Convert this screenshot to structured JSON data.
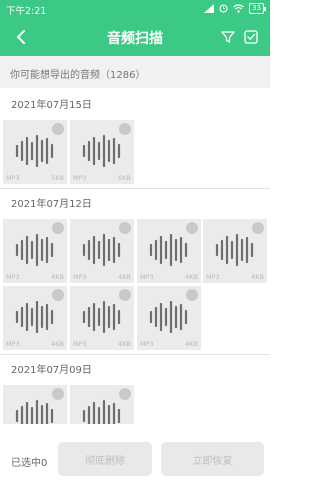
{
  "status_bar": {
    "time": "下午2:21",
    "battery": "33"
  },
  "nav": {
    "title": "音频扫描"
  },
  "summary": "你可能想导出的音频（1286）",
  "groups": [
    {
      "date": "2021年07月15日",
      "items": [
        {
          "format": "MP3",
          "size": "5KB"
        },
        {
          "format": "MP3",
          "size": "6KB"
        }
      ]
    },
    {
      "date": "2021年07月12日",
      "items": [
        {
          "format": "MP3",
          "size": "4KB"
        },
        {
          "format": "MP3",
          "size": "4KB"
        },
        {
          "format": "MP3",
          "size": "4KB"
        },
        {
          "format": "MP3",
          "size": "4KB"
        },
        {
          "format": "MP3",
          "size": "4KB"
        },
        {
          "format": "MP3",
          "size": "4KB"
        },
        {
          "format": "MP3",
          "size": "4KB"
        }
      ]
    },
    {
      "date": "2021年07月09日",
      "items": [
        {
          "format": "",
          "size": ""
        },
        {
          "format": "",
          "size": ""
        }
      ]
    }
  ],
  "bottom": {
    "selected": "已选中0",
    "delete_label": "彻底删除",
    "restore_label": "立即恢复"
  },
  "colors": {
    "accent": "#3cc985",
    "tile_bg": "#ebebeb",
    "wave": "#6e6e6e"
  },
  "icons": {
    "back": "chevron-left-icon",
    "filter": "filter-icon",
    "select_all": "select-all-icon",
    "wave": "audio-wave-icon"
  }
}
